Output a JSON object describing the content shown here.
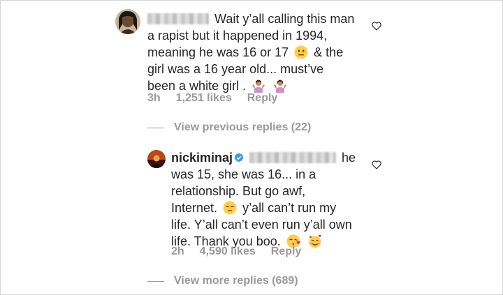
{
  "comment1": {
    "text_line1": "Wait y’all calling this man",
    "text_line2": "a rapist but it happened in 1994,",
    "text_line3a": "meaning he was 16 or 17",
    "text_line3b": "& the",
    "text_line4": "girl was a 16 year old... must’ve",
    "text_line5": "been a white girl .",
    "time": "3h",
    "likes": "1,251 likes",
    "reply_label": "Reply"
  },
  "view_previous_replies": "View previous replies (22)",
  "reply1": {
    "username": "nickiminaj",
    "text_line1_end": "he",
    "text_line2": "was 15, she was 16... in a",
    "text_line3": "relationship. But go awf,",
    "text_line4a": "Internet.",
    "text_line4b": "y’all can’t run my",
    "text_line5": "life. Y’all can’t even run y’all own",
    "text_line6": "life. Thank you boo.",
    "time": "2h",
    "likes": "4,590 likes",
    "reply_label": "Reply"
  },
  "view_more_replies": "View more replies (689)",
  "colors": {
    "text": "#262626",
    "meta": "#999999",
    "verified": "#3897f0"
  },
  "icons": [
    "heart-icon",
    "verified-badge-icon",
    "neutral-face-emoji",
    "shrug-emoji",
    "unamused-face-emoji",
    "kissing-heart-emoji",
    "smiling-hearts-emoji"
  ]
}
